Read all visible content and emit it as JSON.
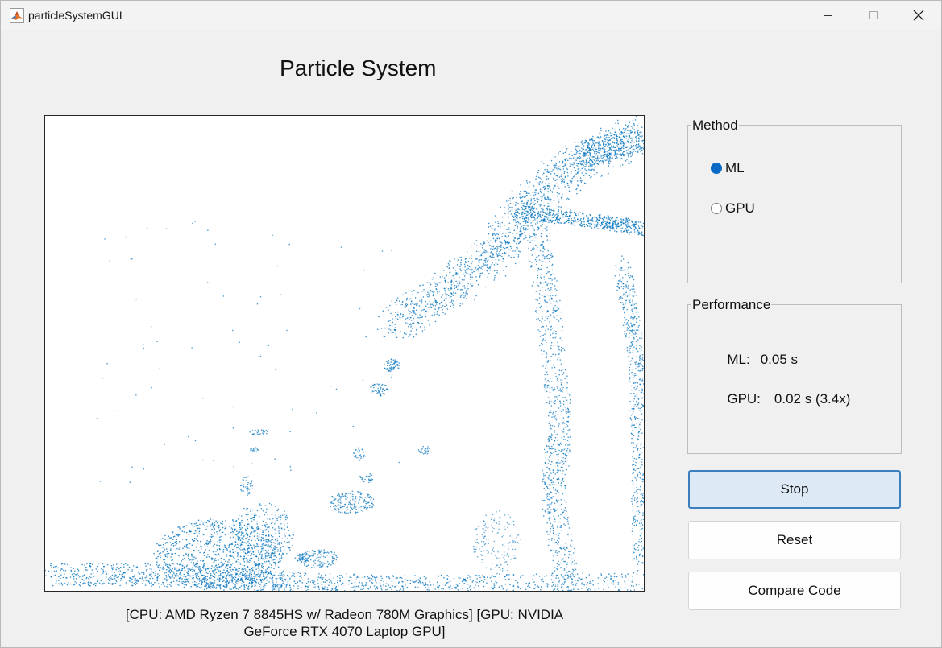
{
  "window": {
    "title": "particleSystemGUI"
  },
  "header": {
    "title": "Particle System"
  },
  "plot": {
    "caption_line1": "[CPU: AMD Ryzen 7 8845HS w/ Radeon 780M Graphics] [GPU: NVIDIA",
    "caption_line2": "GeForce RTX 4070 Laptop GPU]",
    "particle_color": "#0072bd"
  },
  "method": {
    "title": "Method",
    "options": [
      {
        "label": "ML",
        "selected": true
      },
      {
        "label": "GPU",
        "selected": false
      }
    ]
  },
  "performance": {
    "title": "Performance",
    "ml_label": "ML:",
    "ml_value": "0.05 s",
    "gpu_label": "GPU:",
    "gpu_value": "0.02 s (3.4x)"
  },
  "buttons": {
    "stop": "Stop",
    "reset": "Reset",
    "compare": "Compare Code"
  },
  "colors": {
    "accent": "#0065c3",
    "focus_button_bg": "#ddeaf6",
    "focus_button_border": "#3c7fc1"
  }
}
